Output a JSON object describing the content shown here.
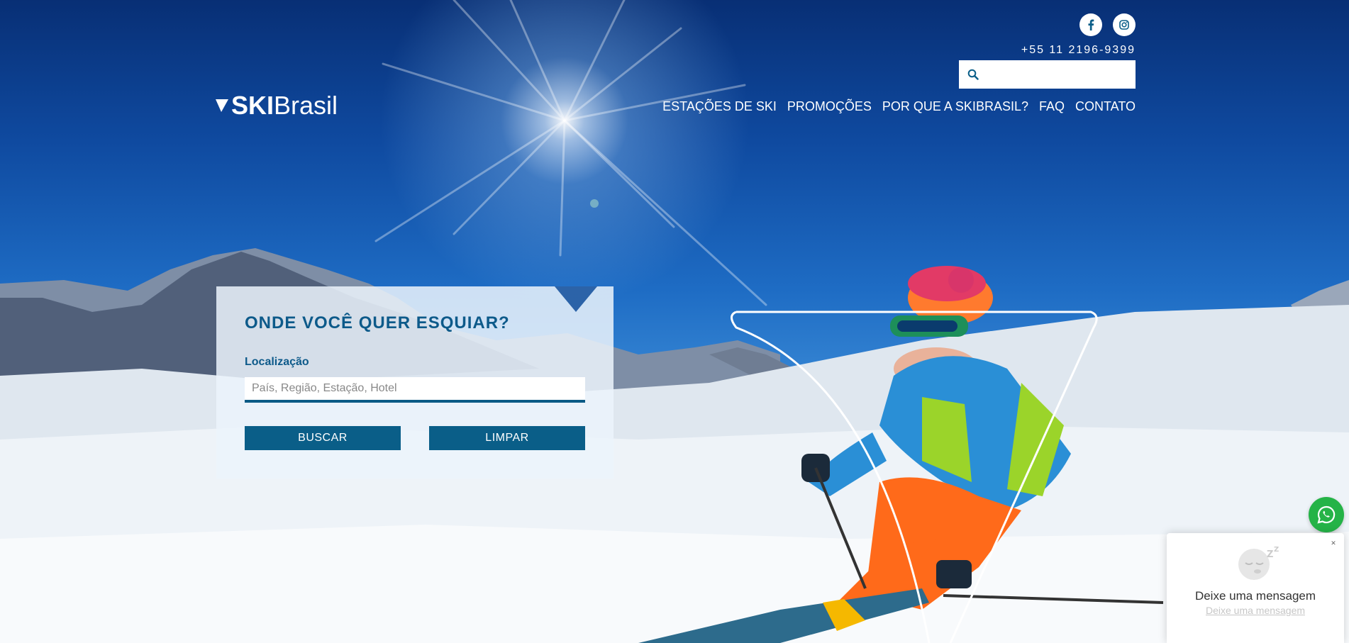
{
  "brand": {
    "logo_bold": "SKI",
    "logo_light": "Brasil"
  },
  "header": {
    "phone": "+55 11 2196-9399",
    "search_placeholder": "",
    "social": [
      "facebook-icon",
      "instagram-icon"
    ]
  },
  "nav": {
    "items": [
      {
        "label": "ESTAÇÕES DE SKI"
      },
      {
        "label": "PROMOÇÕES"
      },
      {
        "label": "POR QUE A SKIBRASIL?"
      },
      {
        "label": "FAQ"
      },
      {
        "label": "CONTATO"
      }
    ]
  },
  "search_panel": {
    "title": "ONDE VOCÊ QUER ESQUIAR?",
    "location_label": "Localização",
    "location_placeholder": "País, Região, Estação, Hotel",
    "search_button": "BUSCAR",
    "clear_button": "LIMPAR"
  },
  "chat": {
    "title": "Deixe uma mensagem",
    "link": "Deixe uma mensagem"
  },
  "colors": {
    "primary": "#0a5e88",
    "whatsapp": "#25b347"
  }
}
